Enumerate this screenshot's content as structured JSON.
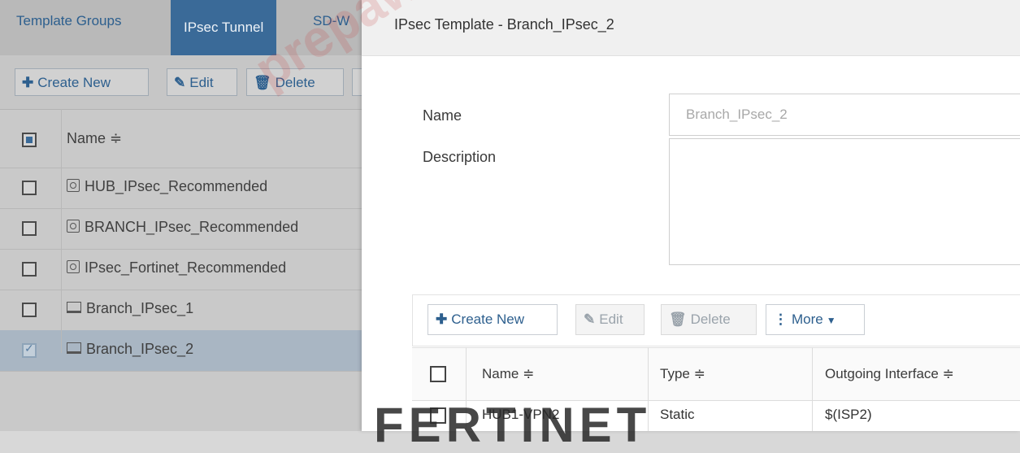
{
  "tabs": [
    {
      "label": "Template Groups"
    },
    {
      "label": "IPsec Tunnel"
    },
    {
      "label": "SD-W"
    }
  ],
  "left_toolbar": {
    "create_label": "Create New",
    "edit_label": "Edit",
    "delete_label": "Delete"
  },
  "left_table": {
    "name_header": "Name ≑",
    "rows": [
      {
        "name": "HUB_IPsec_Recommended",
        "icon": "recommended-template-icon",
        "selected": false
      },
      {
        "name": "BRANCH_IPsec_Recommended",
        "icon": "recommended-template-icon",
        "selected": false
      },
      {
        "name": "IPsec_Fortinet_Recommended",
        "icon": "recommended-template-icon",
        "selected": false
      },
      {
        "name": "Branch_IPsec_1",
        "icon": "laptop-icon",
        "selected": false
      },
      {
        "name": "Branch_IPsec_2",
        "icon": "laptop-icon",
        "selected": true
      }
    ]
  },
  "dialog": {
    "title": "IPsec Template - Branch_IPsec_2",
    "name_label": "Name",
    "name_value": "Branch_IPsec_2",
    "description_label": "Description",
    "description_value": "",
    "toolbar": {
      "create_label": "Create New",
      "edit_label": "Edit",
      "delete_label": "Delete",
      "more_label": "More"
    },
    "table": {
      "headers": [
        "Name ≑",
        "Type ≑",
        "Outgoing Interface ≑"
      ],
      "rows": [
        {
          "name": "HUB1-VPN2",
          "type": "Static",
          "interface": "$(ISP2)"
        }
      ]
    }
  },
  "watermarks": {
    "diagonal": "prepaway",
    "brand": "FERTINET"
  },
  "colors": {
    "accent": "#3a6a98",
    "link": "#2d5f8e"
  }
}
